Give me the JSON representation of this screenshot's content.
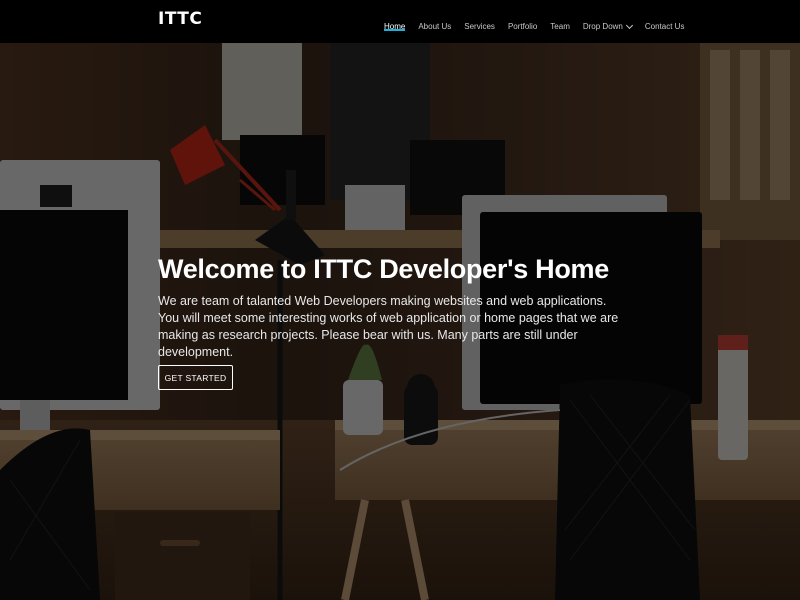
{
  "brand": {
    "name": "ITTC"
  },
  "nav": {
    "items": [
      {
        "label": "Home",
        "active": true
      },
      {
        "label": "About Us"
      },
      {
        "label": "Services"
      },
      {
        "label": "Portfolio"
      },
      {
        "label": "Team"
      },
      {
        "label": "Drop Down",
        "has_dropdown": true
      },
      {
        "label": "Contact Us"
      }
    ]
  },
  "hero": {
    "title": "Welcome to ITTC Developer's Home",
    "description_lines": [
      "We are team of talanted Web Developers making websites and web applications.",
      "You will meet some interesting works of web application or home pages that we are making as research projects. Please bear with us. Many parts are still under development."
    ],
    "cta_label": "GET STARTED",
    "background_image": "office-workspace-photo"
  },
  "colors": {
    "navbar_bg": "#000000",
    "accent": "#1bb1dc",
    "text": "#ffffff"
  }
}
